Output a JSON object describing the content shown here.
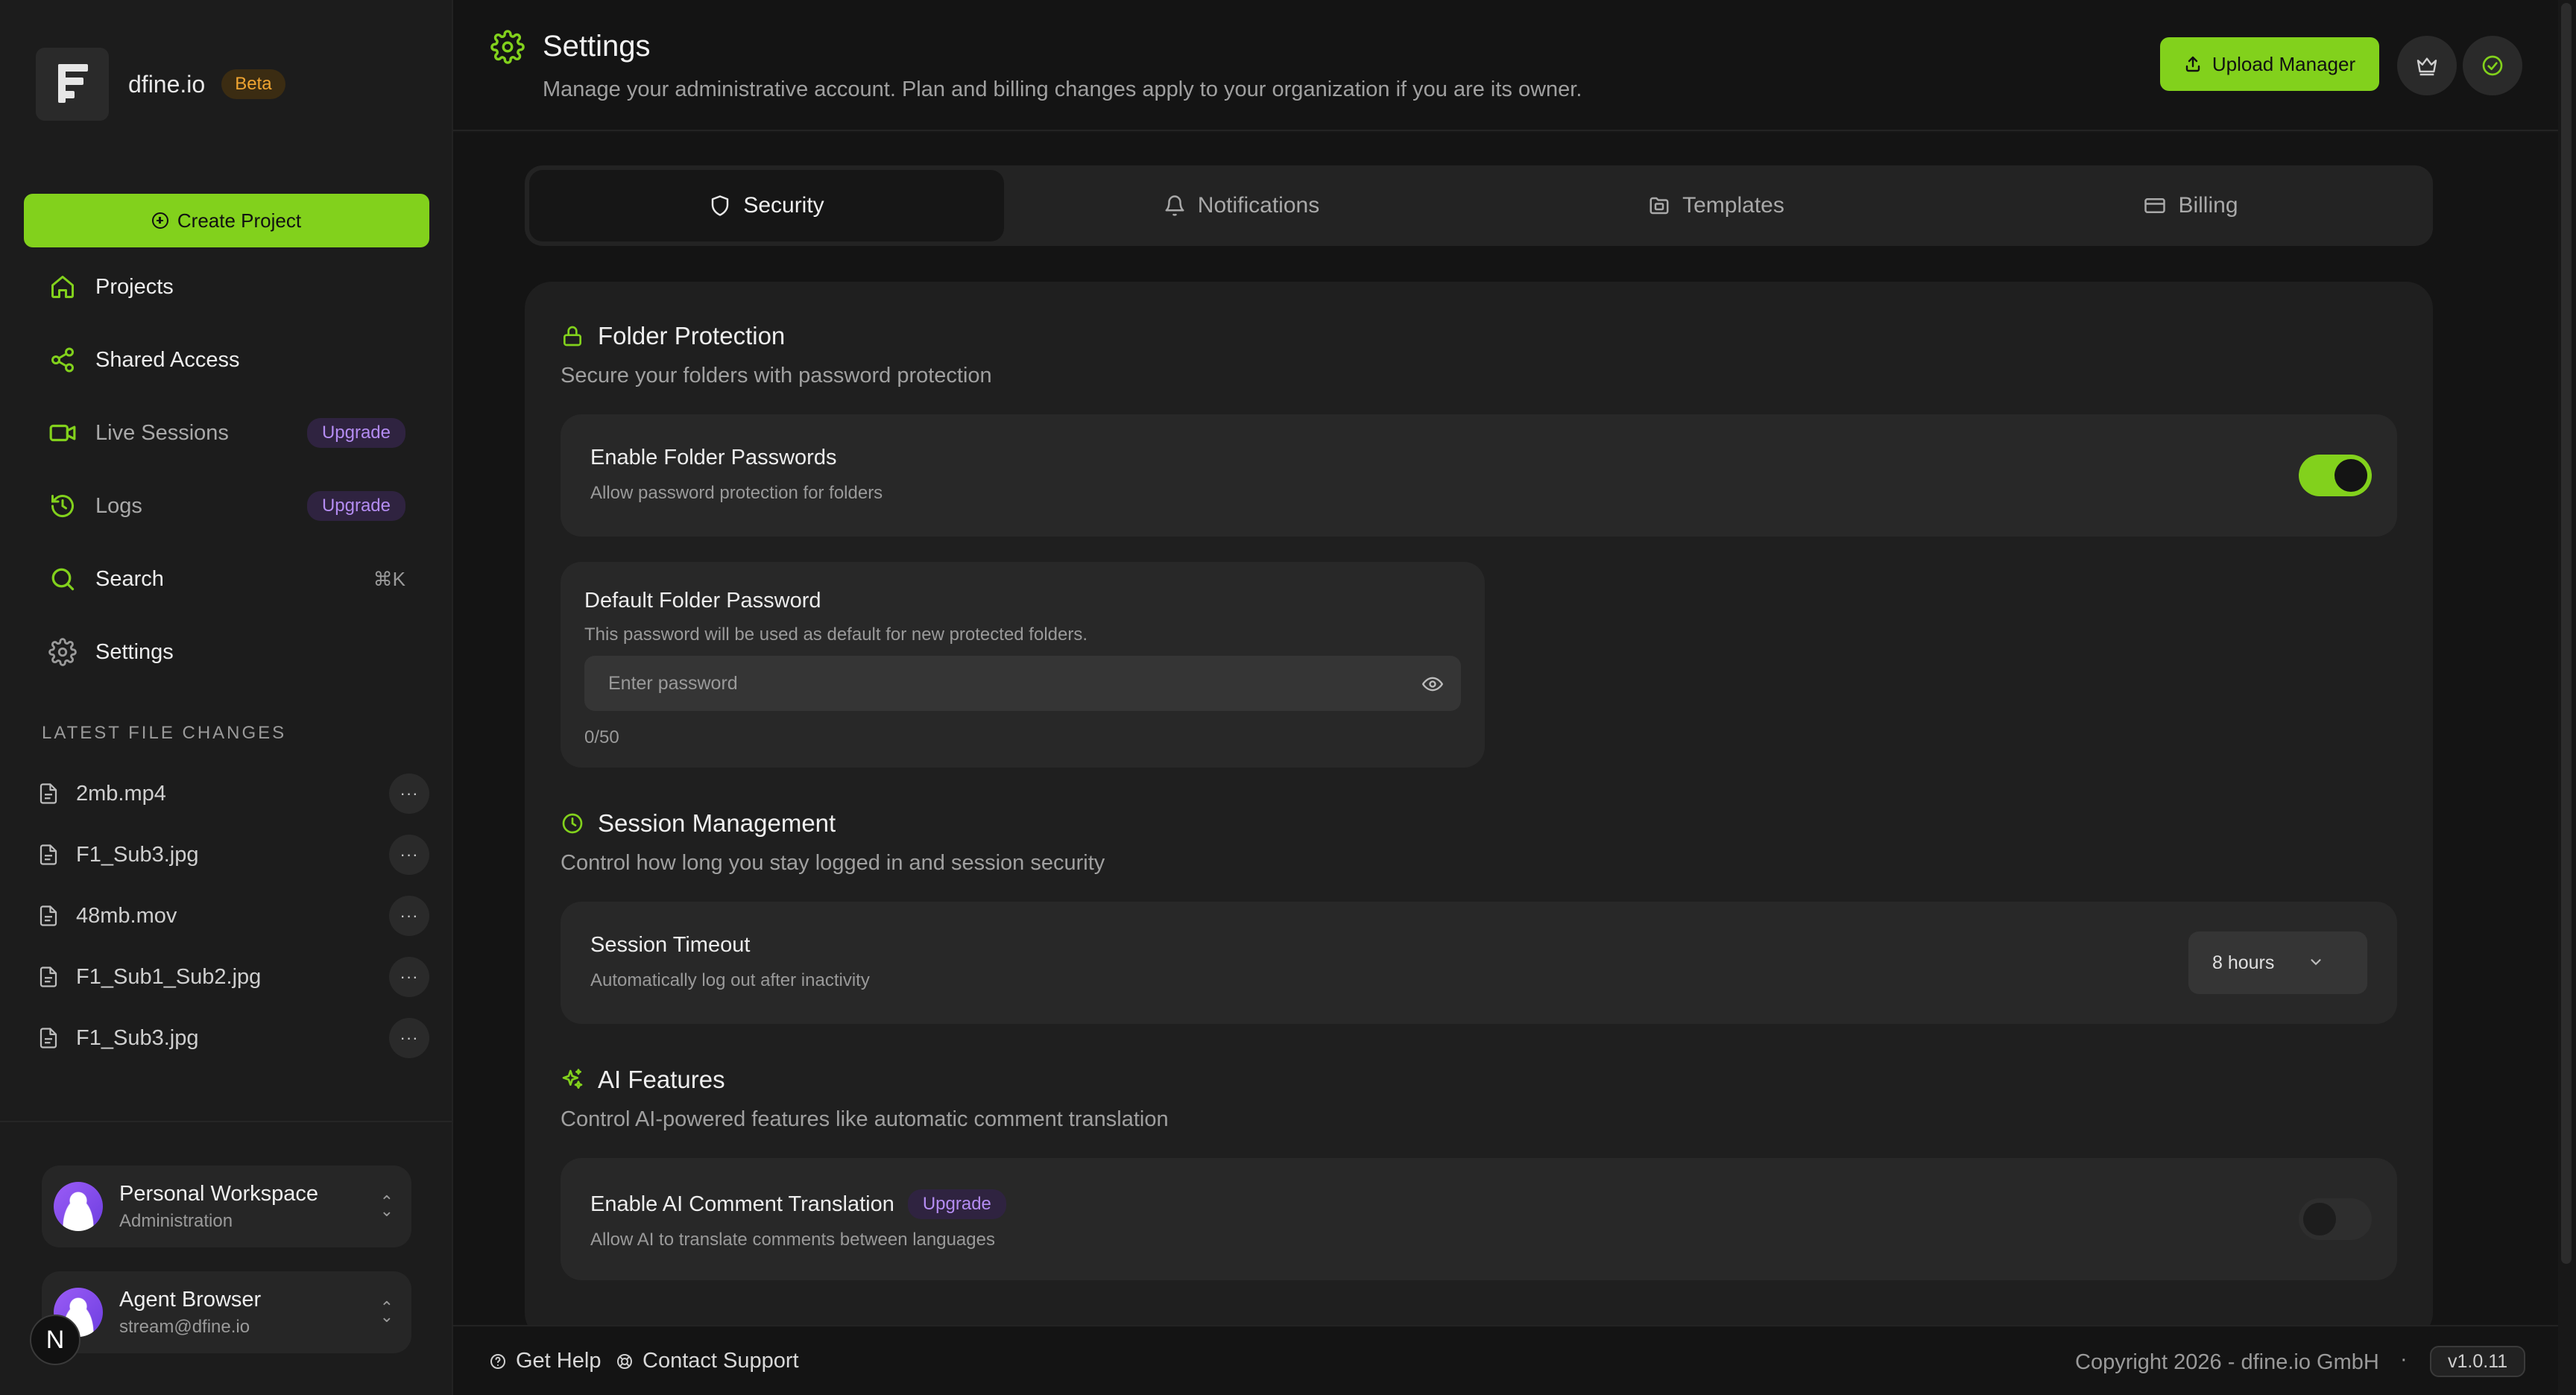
{
  "brand": {
    "name": "dfine.io",
    "badge": "Beta"
  },
  "sidebar": {
    "create_label": "Create Project",
    "items": [
      {
        "label": "Projects",
        "icon": "home-icon"
      },
      {
        "label": "Shared Access",
        "icon": "share-icon"
      },
      {
        "label": "Live Sessions",
        "icon": "video-icon",
        "badge": "Upgrade"
      },
      {
        "label": "Logs",
        "icon": "history-icon",
        "badge": "Upgrade"
      },
      {
        "label": "Search",
        "icon": "search-icon",
        "shortcut": "⌘K"
      },
      {
        "label": "Settings",
        "icon": "gear-icon"
      }
    ],
    "files_title": "LATEST FILE CHANGES",
    "files": [
      {
        "name": "2mb.mp4",
        "action": "···"
      },
      {
        "name": "F1_Sub3.jpg",
        "action": "···"
      },
      {
        "name": "48mb.mov",
        "action": "···"
      },
      {
        "name": "F1_Sub1_Sub2.jpg",
        "action": "···"
      },
      {
        "name": "F1_Sub3.jpg",
        "action": "···"
      }
    ],
    "workspace": {
      "name": "Personal Workspace",
      "role": "Administration"
    },
    "account": {
      "name": "Agent Browser",
      "email": "stream@dfine.io"
    },
    "corner_badge": "N"
  },
  "header": {
    "title": "Settings",
    "subtitle": "Manage your administrative account. Plan and billing changes apply to your organization if you are its owner.",
    "upload_label": "Upload Manager"
  },
  "tabs": [
    {
      "label": "Security",
      "icon": "shield-icon",
      "active": true
    },
    {
      "label": "Notifications",
      "icon": "bell-icon",
      "active": false
    },
    {
      "label": "Templates",
      "icon": "folder-icon",
      "active": false
    },
    {
      "label": "Billing",
      "icon": "card-icon",
      "active": false
    }
  ],
  "security": {
    "folder_protection": {
      "title": "Folder Protection",
      "subtitle": "Secure your folders with password protection",
      "enable": {
        "title": "Enable Folder Passwords",
        "desc": "Allow password protection for folders",
        "enabled": true
      },
      "default_password": {
        "title": "Default Folder Password",
        "desc": "This password will be used as default for new protected folders.",
        "placeholder": "Enter password",
        "value": "",
        "counter": "0/50"
      }
    },
    "session_management": {
      "title": "Session Management",
      "subtitle": "Control how long you stay logged in and session security",
      "timeout": {
        "title": "Session Timeout",
        "desc": "Automatically log out after inactivity",
        "value": "8 hours"
      }
    },
    "ai_features": {
      "title": "AI Features",
      "subtitle": "Control AI-powered features like automatic comment translation",
      "translation": {
        "title": "Enable AI Comment Translation",
        "badge": "Upgrade",
        "desc": "Allow AI to translate comments between languages",
        "enabled": false
      }
    }
  },
  "footer": {
    "help": "Get Help",
    "support": "Contact Support",
    "copyright": "Copyright 2026 - dfine.io GmbH",
    "separator": "·",
    "version": "v1.0.11"
  },
  "colors": {
    "accent": "#82d11c",
    "upgrade": "#b48cf2",
    "beta": "#f0a431",
    "background": "#141414"
  }
}
